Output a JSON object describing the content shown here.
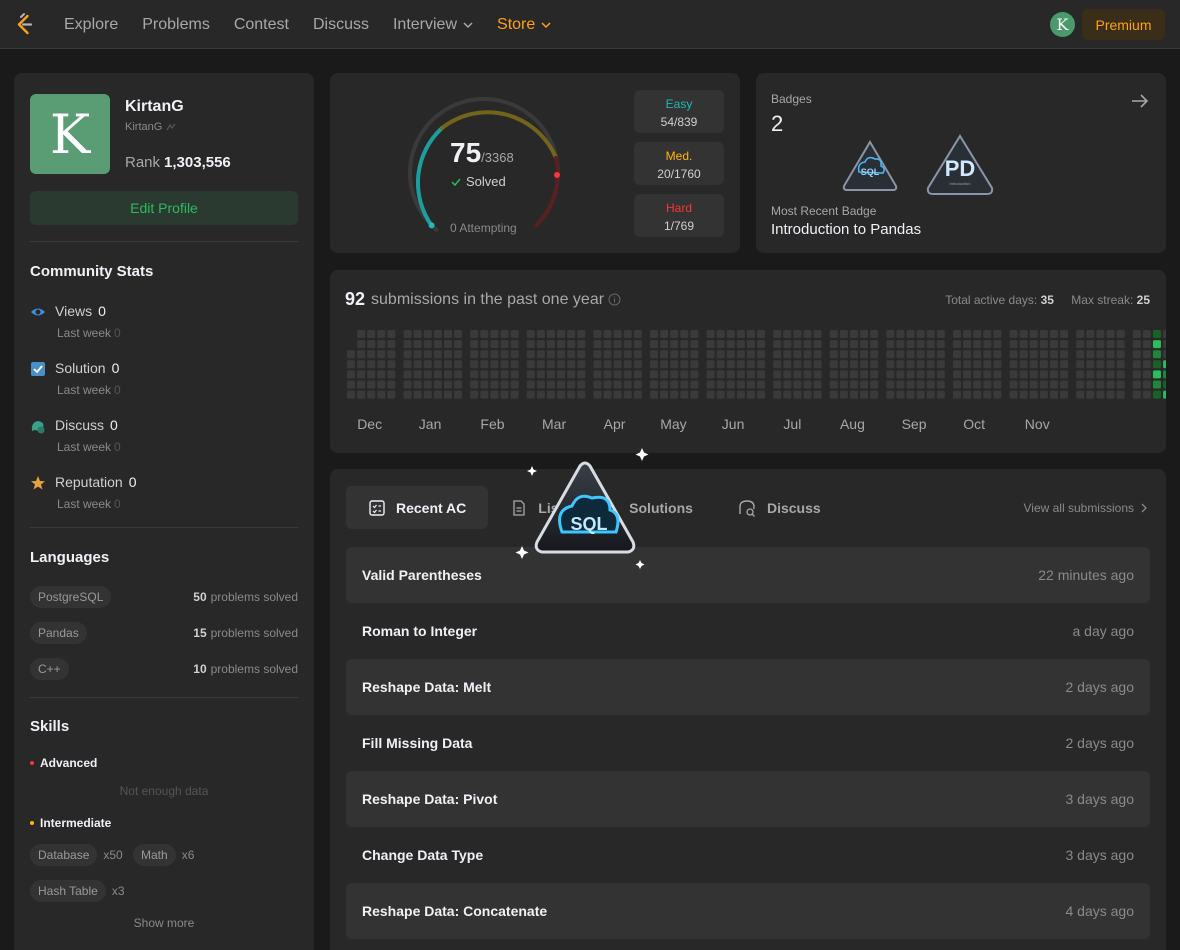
{
  "nav": {
    "links": [
      "Explore",
      "Problems",
      "Contest",
      "Discuss",
      "Interview",
      "Store"
    ],
    "avatar_letter": "K",
    "premium": "Premium"
  },
  "profile": {
    "avatar_letter": "K",
    "name": "KirtanG",
    "handle": "KirtanG",
    "rank_label": "Rank",
    "rank_value": "1,303,556",
    "edit": "Edit Profile"
  },
  "community": {
    "title": "Community Stats",
    "items": [
      {
        "label": "Views",
        "value": "0",
        "sub": "Last week",
        "sub_value": "0",
        "icon": "eye-icon"
      },
      {
        "label": "Solution",
        "value": "0",
        "sub": "Last week",
        "sub_value": "0",
        "icon": "checkbox-icon"
      },
      {
        "label": "Discuss",
        "value": "0",
        "sub": "Last week",
        "sub_value": "0",
        "icon": "chat-icon"
      },
      {
        "label": "Reputation",
        "value": "0",
        "sub": "Last week",
        "sub_value": "0",
        "icon": "star-icon"
      }
    ]
  },
  "languages": {
    "title": "Languages",
    "items": [
      {
        "name": "PostgreSQL",
        "count": "50",
        "suffix": "problems solved"
      },
      {
        "name": "Pandas",
        "count": "15",
        "suffix": "problems solved"
      },
      {
        "name": "C++",
        "count": "10",
        "suffix": "problems solved"
      }
    ]
  },
  "skills": {
    "title": "Skills",
    "advanced": "Advanced",
    "no_data": "Not enough data",
    "intermediate": "Intermediate",
    "tags": [
      {
        "name": "Database",
        "count": "x50"
      },
      {
        "name": "Math",
        "count": "x6"
      },
      {
        "name": "Hash Table",
        "count": "x3"
      }
    ],
    "show_more": "Show more"
  },
  "progress": {
    "solved": "75",
    "total": "/3368",
    "solved_label": "Solved",
    "attempting": "0 Attempting",
    "difficulties": [
      {
        "name": "Easy",
        "value": "54/839",
        "color": "#1cbaba"
      },
      {
        "name": "Med.",
        "value": "20/1760",
        "color": "#ffb700"
      },
      {
        "name": "Hard",
        "value": "1/769",
        "color": "#f63737"
      }
    ]
  },
  "badges": {
    "title": "Badges",
    "count": "2",
    "recent_label": "Most Recent Badge",
    "recent_name": "Introduction to Pandas",
    "badge1_text": "SQL",
    "badge2_text": "PD",
    "badge2_sub": "Introduction"
  },
  "heatmap": {
    "count": "92",
    "title": "submissions in the past one year",
    "active_label": "Total active days:",
    "active_value": "35",
    "streak_label": "Max streak:",
    "streak_value": "25",
    "months": [
      "Dec",
      "Jan",
      "Feb",
      "Mar",
      "Apr",
      "May",
      "Jun",
      "Jul",
      "Aug",
      "Sep",
      "Oct",
      "Nov"
    ]
  },
  "submissions": {
    "tabs": [
      "Recent AC",
      "List",
      "Solutions",
      "Discuss"
    ],
    "view_all": "View all submissions",
    "overlay_text": "SQL",
    "rows": [
      {
        "title": "Valid Parentheses",
        "time": "22 minutes ago"
      },
      {
        "title": "Roman to Integer",
        "time": "a day ago"
      },
      {
        "title": "Reshape Data: Melt",
        "time": "2 days ago"
      },
      {
        "title": "Fill Missing Data",
        "time": "2 days ago"
      },
      {
        "title": "Reshape Data: Pivot",
        "time": "3 days ago"
      },
      {
        "title": "Change Data Type",
        "time": "3 days ago"
      },
      {
        "title": "Reshape Data: Concatenate",
        "time": "4 days ago"
      }
    ]
  },
  "colors": {
    "accent": "#ffa116",
    "green": "#2cbb5d",
    "easy": "#1cbaba",
    "medium": "#ffb700",
    "hard": "#f63737"
  }
}
